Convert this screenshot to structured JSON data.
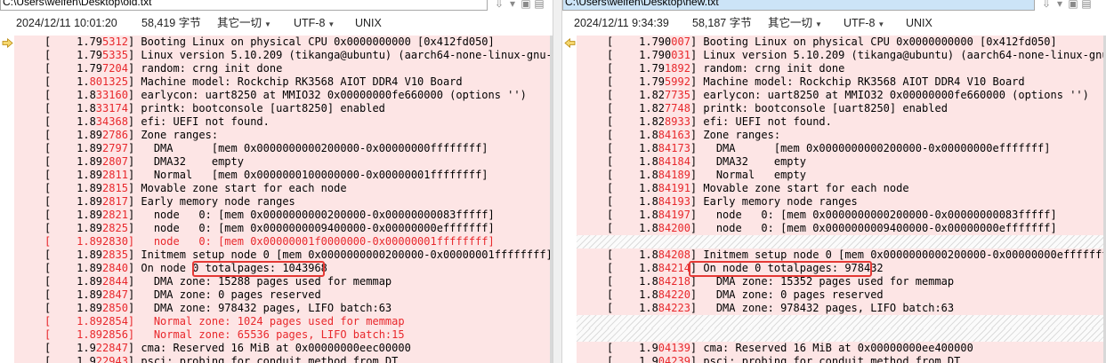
{
  "left": {
    "path": "C:\\Users\\weifen\\Desktop\\old.txt",
    "info": {
      "date": "2024/12/11 10:01:20",
      "size": "58,419 字节",
      "format": "其它一切",
      "encoding": "UTF-8",
      "eol": "UNIX"
    },
    "lines": [
      {
        "type": "diff",
        "pre": "[    1.79",
        "diff": "5312",
        "post": "] Booting Linux on physical CPU 0x0000000000 [0x412fd050]"
      },
      {
        "type": "diff",
        "pre": "[    1.79",
        "diff": "5335",
        "post": "] Linux version 5.10.209 (tikanga@ubuntu) (aarch64-none-linux-gnu-gc"
      },
      {
        "type": "diff",
        "pre": "[    1.79",
        "diff": "7204",
        "post": "] random: crng init done"
      },
      {
        "type": "diff",
        "pre": "[    1.",
        "diff": "801325",
        "post": "] Machine model: Rockchip RK3568 AIOT DDR4 V10 Board"
      },
      {
        "type": "diff",
        "pre": "[    1.8",
        "diff": "33160",
        "post": "] earlycon: uart8250 at MMIO32 0x00000000fe660000 (options '')"
      },
      {
        "type": "diff",
        "pre": "[    1.8",
        "diff": "33174",
        "post": "] printk: bootconsole [uart8250] enabled"
      },
      {
        "type": "diff",
        "pre": "[    1.8",
        "diff": "34368",
        "post": "] efi: UEFI not found."
      },
      {
        "type": "diff",
        "pre": "[    1.89",
        "diff": "2786",
        "post": "] Zone ranges:"
      },
      {
        "type": "diff",
        "pre": "[    1.89",
        "diff": "2797",
        "post": "]   DMA      [mem 0x0000000000200000-0x00000000ffffffff]"
      },
      {
        "type": "diff",
        "pre": "[    1.89",
        "diff": "2807",
        "post": "]   DMA32    empty"
      },
      {
        "type": "diff",
        "pre": "[    1.89",
        "diff": "2811",
        "post": "]   Normal   [mem 0x0000000100000000-0x00000001ffffffff]"
      },
      {
        "type": "diff",
        "pre": "[    1.89",
        "diff": "2815",
        "post": "] Movable zone start for each node"
      },
      {
        "type": "diff",
        "pre": "[    1.89",
        "diff": "2817",
        "post": "] Early memory node ranges"
      },
      {
        "type": "diff",
        "pre": "[    1.89",
        "diff": "2821",
        "post": "]   node   0: [mem 0x0000000000200000-0x00000000083fffff]"
      },
      {
        "type": "diff",
        "pre": "[    1.89",
        "diff": "2825",
        "post": "]   node   0: [mem 0x0000000009400000-0x00000000efffffff]"
      },
      {
        "type": "red",
        "pre": "[    1.892830]",
        "diff": "",
        "post": "   node   0: [mem 0x00000001f0000000-0x00000001ffffffff]"
      },
      {
        "type": "diff",
        "pre": "[    1.89",
        "diff": "2835",
        "post": "] Initmem setup node 0 [mem 0x0000000000200000-0x00000001ffffffff]"
      },
      {
        "type": "diff",
        "pre": "[    1.89",
        "diff": "2840",
        "post": "] On node 0 totalpages: 1043968"
      },
      {
        "type": "diff",
        "pre": "[    1.89",
        "diff": "2844",
        "post": "]   DMA zone: 15288 pages used for memmap"
      },
      {
        "type": "diff",
        "pre": "[    1.89",
        "diff": "2847",
        "post": "]   DMA zone: 0 pages reserved"
      },
      {
        "type": "diff",
        "pre": "[    1.89",
        "diff": "2850",
        "post": "]   DMA zone: 978432 pages, LIFO batch:63"
      },
      {
        "type": "red",
        "pre": "[    1.892854]",
        "diff": "",
        "post": "   Normal zone: 1024 pages used for memmap"
      },
      {
        "type": "red",
        "pre": "[    1.892856]",
        "diff": "",
        "post": "   Normal zone: 65536 pages, LIFO batch:15"
      },
      {
        "type": "diff",
        "pre": "[    1.9",
        "diff": "22847",
        "post": "] cma: Reserved 16 MiB at 0x00000000eec00000"
      },
      {
        "type": "diff",
        "pre": "[    1.9",
        "diff": "22943",
        "post": "] psci: probing for conduit method from DT."
      }
    ]
  },
  "right": {
    "path": "C:\\Users\\weifen\\Desktop\\new.txt",
    "info": {
      "date": "2024/12/11 9:34:39",
      "size": "58,187 字节",
      "format": "其它一切",
      "encoding": "UTF-8",
      "eol": "UNIX"
    },
    "lines": [
      {
        "type": "diff",
        "pre": "[    1.790",
        "diff": "007",
        "post": "] Booting Linux on physical CPU 0x0000000000 [0x412fd050]"
      },
      {
        "type": "diff",
        "pre": "[    1.790",
        "diff": "031",
        "post": "] Linux version 5.10.209 (tikanga@ubuntu) (aarch64-none-linux-gnu-gc"
      },
      {
        "type": "diff",
        "pre": "[    1.79",
        "diff": "1892",
        "post": "] random: crng init done"
      },
      {
        "type": "diff",
        "pre": "[    1.79",
        "diff": "5992",
        "post": "] Machine model: Rockchip RK3568 AIOT DDR4 V10 Board"
      },
      {
        "type": "diff",
        "pre": "[    1.82",
        "diff": "7735",
        "post": "] earlycon: uart8250 at MMIO32 0x00000000fe660000 (options '')"
      },
      {
        "type": "diff",
        "pre": "[    1.82",
        "diff": "7748",
        "post": "] printk: bootconsole [uart8250] enabled"
      },
      {
        "type": "diff",
        "pre": "[    1.82",
        "diff": "8933",
        "post": "] efi: UEFI not found."
      },
      {
        "type": "diff",
        "pre": "[    1.8",
        "diff": "84163",
        "post": "] Zone ranges:"
      },
      {
        "type": "diff",
        "pre": "[    1.8",
        "diff": "84173",
        "post": "]   DMA      [mem 0x0000000000200000-0x00000000efffffff]"
      },
      {
        "type": "diff",
        "pre": "[    1.8",
        "diff": "84184",
        "post": "]   DMA32    empty"
      },
      {
        "type": "diff",
        "pre": "[    1.8",
        "diff": "84189",
        "post": "]   Normal   empty"
      },
      {
        "type": "diff",
        "pre": "[    1.8",
        "diff": "84191",
        "post": "] Movable zone start for each node"
      },
      {
        "type": "diff",
        "pre": "[    1.8",
        "diff": "84193",
        "post": "] Early memory node ranges"
      },
      {
        "type": "diff",
        "pre": "[    1.8",
        "diff": "84197",
        "post": "]   node   0: [mem 0x0000000000200000-0x00000000083fffff]"
      },
      {
        "type": "diff",
        "pre": "[    1.8",
        "diff": "84200",
        "post": "]   node   0: [mem 0x0000000009400000-0x00000000efffffff]"
      },
      {
        "type": "placeholder"
      },
      {
        "type": "diff",
        "pre": "[    1.8",
        "diff": "84208",
        "post": "] Initmem setup node 0 [mem 0x0000000000200000-0x00000000efffffff]"
      },
      {
        "type": "diff",
        "pre": "[    1.8",
        "diff": "84214",
        "post": "] On node 0 totalpages: 978432"
      },
      {
        "type": "diff",
        "pre": "[    1.8",
        "diff": "84218",
        "post": "]   DMA zone: 15352 pages used for memmap"
      },
      {
        "type": "diff",
        "pre": "[    1.8",
        "diff": "84220",
        "post": "]   DMA zone: 0 pages reserved"
      },
      {
        "type": "diff",
        "pre": "[    1.8",
        "diff": "84223",
        "post": "]   DMA zone: 978432 pages, LIFO batch:63"
      },
      {
        "type": "placeholder"
      },
      {
        "type": "placeholder"
      },
      {
        "type": "diff",
        "pre": "[    1.9",
        "diff": "04139",
        "post": "] cma: Reserved 16 MiB at 0x00000000ee400000"
      },
      {
        "type": "diff",
        "pre": "[    1.9",
        "diff": "04239",
        "post": "] psci: probing for conduit method from DT."
      }
    ]
  },
  "highlight": {
    "color": "#e53935"
  }
}
